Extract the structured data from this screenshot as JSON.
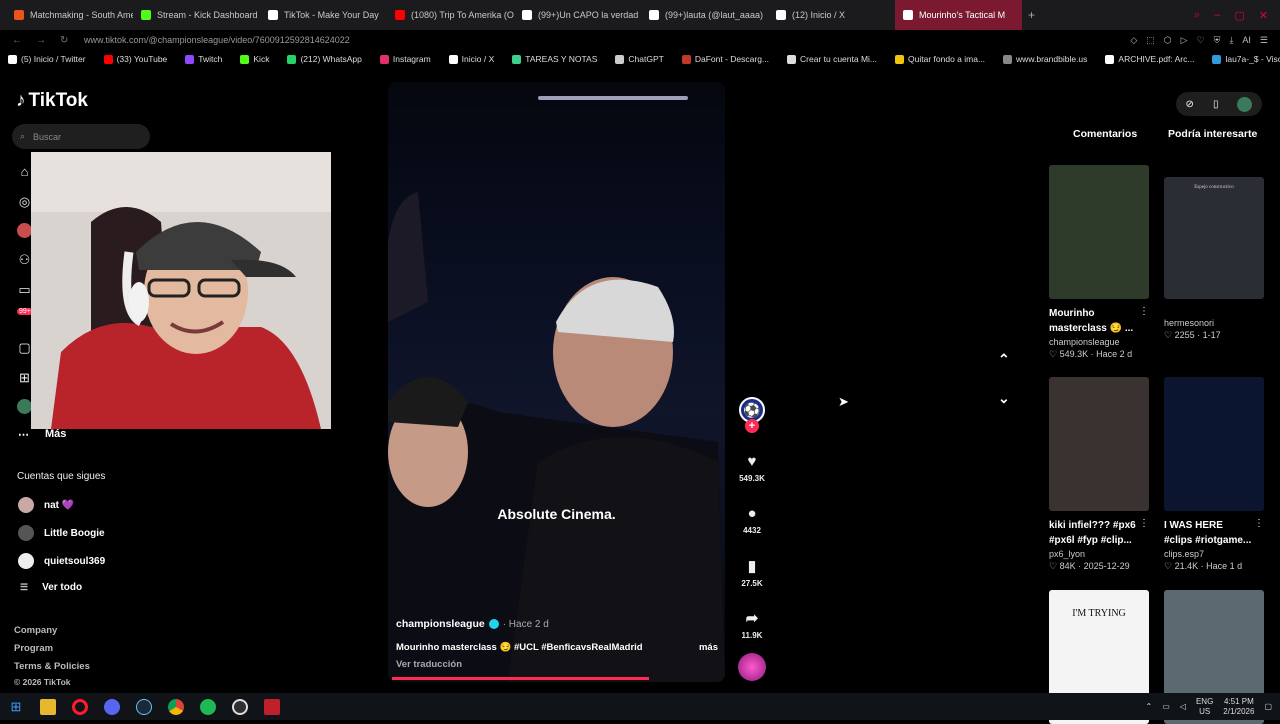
{
  "browser": {
    "tabs": [
      {
        "label": "Matchmaking - South Ame",
        "color": "#e8561c"
      },
      {
        "label": "Stream - Kick Dashboard",
        "color": "#53fc18"
      },
      {
        "label": "TikTok - Make Your Day",
        "color": "#ffffff"
      },
      {
        "label": "(1080) Trip To Amerika (O",
        "color": "#ff0000"
      },
      {
        "label": "(99+)Un CAPO la verdad",
        "color": "#ffffff"
      },
      {
        "label": "(99+)lauta (@laut_aaaa)",
        "color": "#ffffff"
      },
      {
        "label": "(12) Inicio / X",
        "color": "#ffffff"
      },
      {
        "label": "Mourinho's Tactical M",
        "color": "#ffffff"
      }
    ],
    "url": "www.tiktok.com/@championsleague/video/7600912592814624022",
    "ai_label": "AI",
    "bookmarks": [
      {
        "label": "(5) Inicio / Twitter",
        "color": "#ffffff"
      },
      {
        "label": "(33) YouTube",
        "color": "#ff0000"
      },
      {
        "label": "Twitch",
        "color": "#9146ff"
      },
      {
        "label": "Kick",
        "color": "#53fc18"
      },
      {
        "label": "(212) WhatsApp",
        "color": "#25d366"
      },
      {
        "label": "Instagram",
        "color": "#e1306c"
      },
      {
        "label": "Inicio / X",
        "color": "#ffffff"
      },
      {
        "label": "TAREAS Y NOTAS",
        "color": "#3ecf8e"
      },
      {
        "label": "ChatGPT",
        "color": "#cccccc"
      },
      {
        "label": "DaFont - Descarg...",
        "color": "#c0392b"
      },
      {
        "label": "Crear tu cuenta Mi...",
        "color": "#dddddd"
      },
      {
        "label": "Quitar fondo a ima...",
        "color": "#f1c40f"
      },
      {
        "label": "www.brandbible.us",
        "color": "#888888"
      },
      {
        "label": "ARCHIVE.pdf: Arc...",
        "color": "#ffffff"
      },
      {
        "label": "lau7a-_$ - Viscos...",
        "color": "#3498db"
      }
    ]
  },
  "sidebar": {
    "logo": "TikTok",
    "search_placeholder": "Buscar",
    "more_label": "Más",
    "following_header": "Cuentas que sigues",
    "following": [
      {
        "name": "nat 💜",
        "color": "#c9a9a6"
      },
      {
        "name": "Little Boogie",
        "color": "#555555"
      },
      {
        "name": "quietsoul369",
        "color": "#eeeeee"
      }
    ],
    "see_all": "Ver todo",
    "badge": "99+",
    "footer": [
      "Company",
      "Program",
      "Terms & Policies"
    ],
    "copyright": "© 2026 TikTok"
  },
  "video": {
    "caption_overlay": "Absolute Cinema.",
    "author": "championsleague",
    "posted": "· Hace 2 d",
    "description": "Mourinho masterclass 😏 #UCL #BenficavsRealMadrid",
    "more": "más",
    "translate": "Ver traducción",
    "progress": 0.78,
    "likes": "549.3K",
    "comments": "4432",
    "saves": "27.5K",
    "shares": "11.9K"
  },
  "right_panel": {
    "tabs": [
      "Comentarios",
      "Podría interesarte"
    ],
    "items": [
      {
        "title": "Mourinho masterclass 😏 ...",
        "user": "championsleague",
        "stats": "♡ 549.3K · Hace 2 d",
        "bg": "#2e3a2a",
        "thumb_text": ""
      },
      {
        "title": "",
        "user": "hermesonori",
        "stats": "♡ 2255 · 1-17",
        "bg": "#2a2d33",
        "thumb_text": "Espejo constructivo"
      },
      {
        "title": "kiki infiel??? #px6 #px6l #fyp #clip...",
        "user": "px6_lyon",
        "stats": "♡ 84K · 2025-12-29",
        "bg": "#3a3230",
        "thumb_text": ""
      },
      {
        "title": "I WAS HERE #clips #riotgame...",
        "user": "clips.esp7",
        "stats": "♡ 21.4K · Hace 1 d",
        "bg": "#0b1530",
        "thumb_text": ""
      },
      {
        "title": "",
        "user": "",
        "stats": "",
        "bg": "#f4f4f4",
        "thumb_text": "I'M TRYING"
      },
      {
        "title": "",
        "user": "",
        "stats": "",
        "bg": "#5a6a70",
        "thumb_text": ""
      }
    ]
  },
  "taskbar": {
    "lang": "ENG",
    "region": "US",
    "time": "4:51 PM",
    "date": "2/1/2026"
  }
}
